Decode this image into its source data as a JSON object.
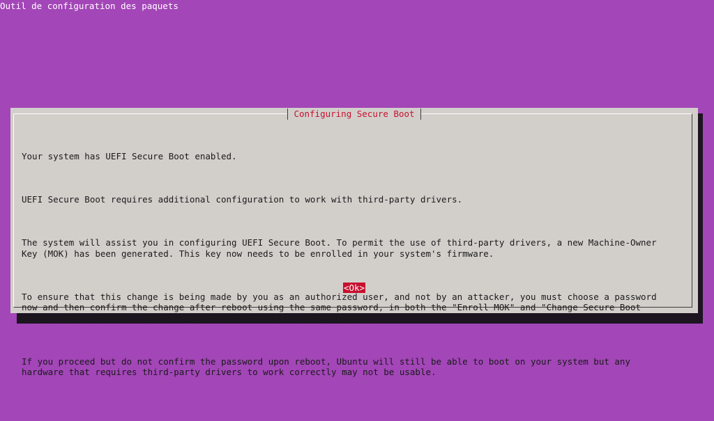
{
  "backtitle": "Outil de configuration des paquets",
  "dialog": {
    "title": "Configuring Secure Boot",
    "paragraphs": [
      "Your system has UEFI Secure Boot enabled.",
      "UEFI Secure Boot requires additional configuration to work with third-party drivers.",
      "The system will assist you in configuring UEFI Secure Boot. To permit the use of third-party drivers, a new Machine-Owner\nKey (MOK) has been generated. This key now needs to be enrolled in your system's firmware.",
      "To ensure that this change is being made by you as an authorized user, and not by an attacker, you must choose a password\nnow and then confirm the change after reboot using the same password, in both the \"Enroll MOK\" and \"Change Secure Boot\nstate\" menus that will be presented to you when this system reboots.",
      "If you proceed but do not confirm the password upon reboot, Ubuntu will still be able to boot on your system but any\nhardware that requires third-party drivers to work correctly may not be usable."
    ],
    "ok_label": "<Ok>"
  },
  "colors": {
    "background": "#a346b8",
    "dialog_background": "#d2cfcb",
    "accent": "#c8102e",
    "shadow": "#1c1520"
  }
}
